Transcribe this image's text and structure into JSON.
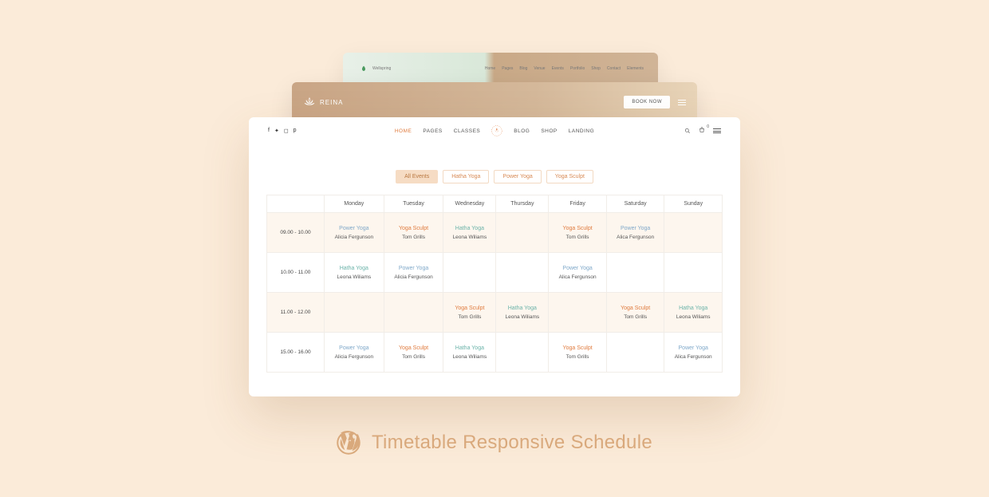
{
  "back2": {
    "brand": "Wellspring",
    "menu": [
      "Home",
      "Pages",
      "Blog",
      "Venue",
      "Events",
      "Portfolio",
      "Shop",
      "Contact",
      "Elements"
    ]
  },
  "back1": {
    "brand": "REINA",
    "cta": "BOOK NOW"
  },
  "nav": {
    "menu_left": [
      "HOME",
      "PAGES",
      "CLASSES"
    ],
    "menu_right": [
      "BLOG",
      "SHOP",
      "LANDING"
    ],
    "cart_count": "0"
  },
  "filters": [
    "All Events",
    "Hatha Yoga",
    "Power Yoga",
    "Yoga Sculpt"
  ],
  "days": [
    "Monday",
    "Tuesday",
    "Wednesday",
    "Thursday",
    "Friday",
    "Saturday",
    "Sunday"
  ],
  "times": [
    "09.00 - 10.00",
    "10.00 - 11.00",
    "11.00 - 12.00",
    "15.00 - 16.00"
  ],
  "classes": {
    "power": "Power Yoga",
    "sculpt": "Yoga Sculpt",
    "hatha": "Hatha Yoga"
  },
  "instructors": {
    "alicia": "Alicia Fergunson",
    "tom": "Tom Grills",
    "leona": "Leona Wiliams",
    "alica": "Alica Fergunson"
  },
  "grid": [
    [
      {
        "cls": "power",
        "who": "alicia"
      },
      {
        "cls": "sculpt",
        "who": "tom"
      },
      {
        "cls": "hatha",
        "who": "leona"
      },
      null,
      {
        "cls": "sculpt",
        "who": "tom"
      },
      {
        "cls": "power",
        "who": "alica"
      },
      null
    ],
    [
      {
        "cls": "hatha",
        "who": "leona"
      },
      {
        "cls": "power",
        "who": "alicia"
      },
      null,
      null,
      {
        "cls": "power",
        "who": "alica"
      },
      null,
      null
    ],
    [
      null,
      null,
      {
        "cls": "sculpt",
        "who": "tom"
      },
      {
        "cls": "hatha",
        "who": "leona"
      },
      null,
      {
        "cls": "sculpt",
        "who": "tom"
      },
      {
        "cls": "hatha",
        "who": "leona"
      }
    ],
    [
      {
        "cls": "power",
        "who": "alicia"
      },
      {
        "cls": "sculpt",
        "who": "tom"
      },
      {
        "cls": "hatha",
        "who": "leona"
      },
      null,
      {
        "cls": "sculpt",
        "who": "tom"
      },
      null,
      {
        "cls": "power",
        "who": "alica"
      }
    ]
  ],
  "footer": {
    "title": "Timetable Responsive Schedule"
  }
}
